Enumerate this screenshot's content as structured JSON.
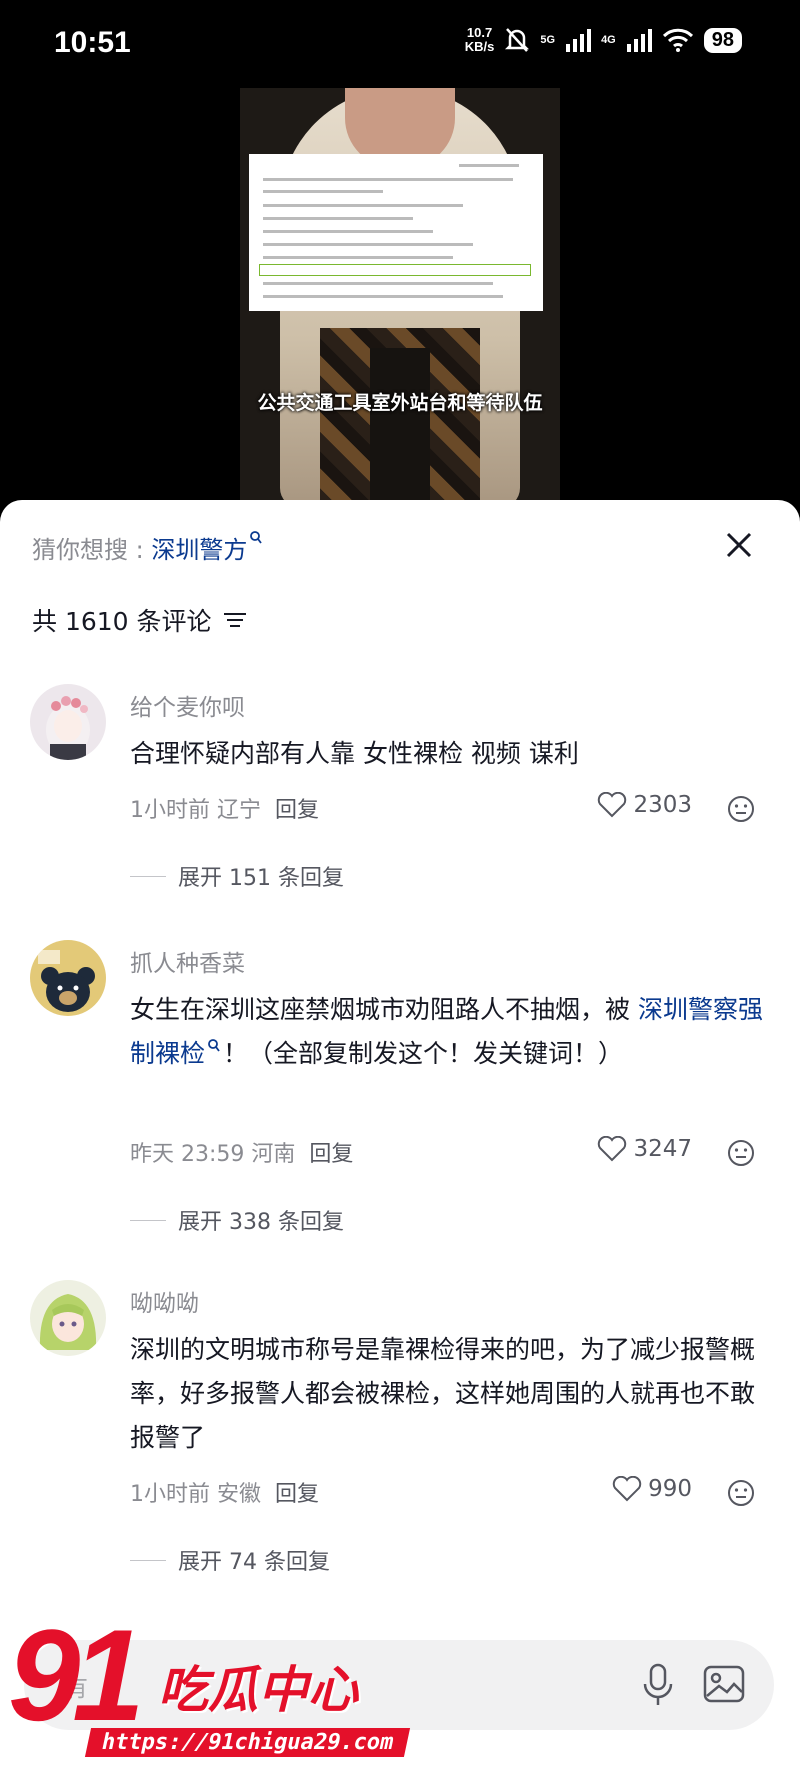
{
  "status_bar": {
    "time": "10:51",
    "net_speed_value": "10.7",
    "net_speed_unit": "KB/s",
    "signal1": "5G",
    "signal2": "4G",
    "battery": "98"
  },
  "video": {
    "caption": "公共交通工具室外站台和等待队伍"
  },
  "sheet": {
    "suggest_prefix": "猜你想搜 : ",
    "suggest_keyword": "深圳警方",
    "comment_count": "共 1610 条评论"
  },
  "comments": [
    {
      "user": "给个麦你呗",
      "text": "合理怀疑内部有人靠 女性裸检 视频 谋利",
      "time_loc": "1小时前 辽宁",
      "reply": "回复",
      "likes": "2303",
      "expand": "展开 151 条回复"
    },
    {
      "user": "抓人种香菜",
      "text_pre": "女生在深圳这座禁烟城市劝阻路人不抽烟，被 ",
      "text_kw": "深圳警察强制裸检",
      "text_post": "！（全部复制发这个！发关键词！）",
      "time_loc": "昨天 23:59 河南",
      "reply": "回复",
      "likes": "3247",
      "expand": "展开 338 条回复"
    },
    {
      "user": "呦呦呦",
      "text": "深圳的文明城市称号是靠裸检得来的吧，为了减少报警概率，好多报警人都会被裸检，这样她周围的人就再也不敢报警了",
      "time_loc": "1小时前 安徽",
      "reply": "回复",
      "likes": "990",
      "expand": "展开 74 条回复"
    }
  ],
  "input": {
    "placeholder": "有"
  },
  "watermark": {
    "number": "91",
    "title": "吃瓜中心",
    "url": "https://91chigua29.com"
  },
  "colors": {
    "keyword": "#0b3a8f",
    "secondary_text": "#8a8b91",
    "watermark_red": "#e4102a"
  }
}
